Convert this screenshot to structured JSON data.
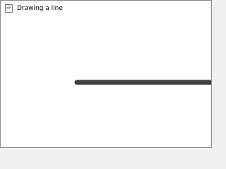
{
  "window": {
    "title": "Drawing a line",
    "icon": "java-cup-icon"
  },
  "canvas": {
    "line_color": "#3f3f3f",
    "background": "#ffffff"
  }
}
